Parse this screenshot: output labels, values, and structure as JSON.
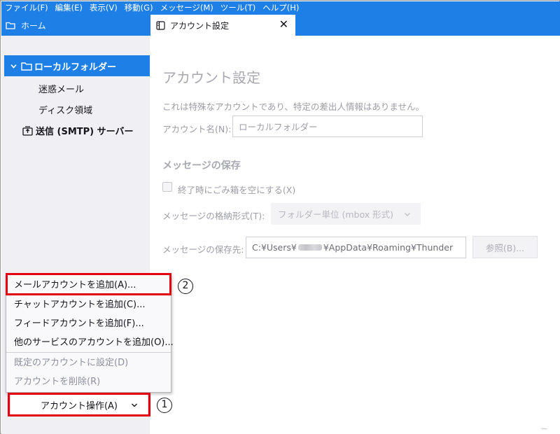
{
  "menubar": {
    "items": [
      "ファイル(F)",
      "編集(E)",
      "表示(V)",
      "移動(G)",
      "メッセージ(M)",
      "ツール(T)",
      "ヘルプ(H)"
    ]
  },
  "tabs": {
    "home_label": "ホーム",
    "active_label": "アカウント設定",
    "close_glyph": "✕"
  },
  "sidebar": {
    "local_folder": "ローカルフォルダー",
    "junk": "迷惑メール",
    "disk_space": "ディスク領域",
    "smtp": "送信 (SMTP) サーバー"
  },
  "menu": {
    "items": [
      {
        "label": "メールアカウントを追加(A)...",
        "enabled": true
      },
      {
        "label": "チャットアカウントを追加(C)...",
        "enabled": true
      },
      {
        "label": "フィードアカウントを追加(F)...",
        "enabled": true
      },
      {
        "label": "他のサービスのアカウントを追加(O)...",
        "enabled": true
      },
      {
        "label": "既定のアカウントに設定(D)",
        "enabled": false
      },
      {
        "label": "アカウントを削除(R)",
        "enabled": false
      }
    ]
  },
  "account_actions_button": "アカウント操作(A)",
  "annotations": {
    "callout_1": "1",
    "callout_2": "2",
    "highlight_color": "#e3000f"
  },
  "main": {
    "title": "アカウント設定",
    "description": "これは特殊なアカウントであり、特定の差出人情報はありません。",
    "account_name_label": "アカウント名(N):",
    "account_name_value": "ローカルフォルダー",
    "storage_heading": "メッセージの保存",
    "empty_trash_label": "終了時にごみ箱を空にする(X)",
    "store_type_label": "メッセージの格納形式(T):",
    "store_type_value": "フォルダー単位 (mbox 形式)",
    "local_dir_label": "メッセージの保存先:",
    "local_dir_prefix": "C:¥Users¥",
    "local_dir_suffix": "¥AppData¥Roaming¥Thunder",
    "browse_button": "参照(B)..."
  },
  "colors": {
    "accent": "#1e7fe6",
    "sidebar_bg": "#f0f0f4"
  }
}
